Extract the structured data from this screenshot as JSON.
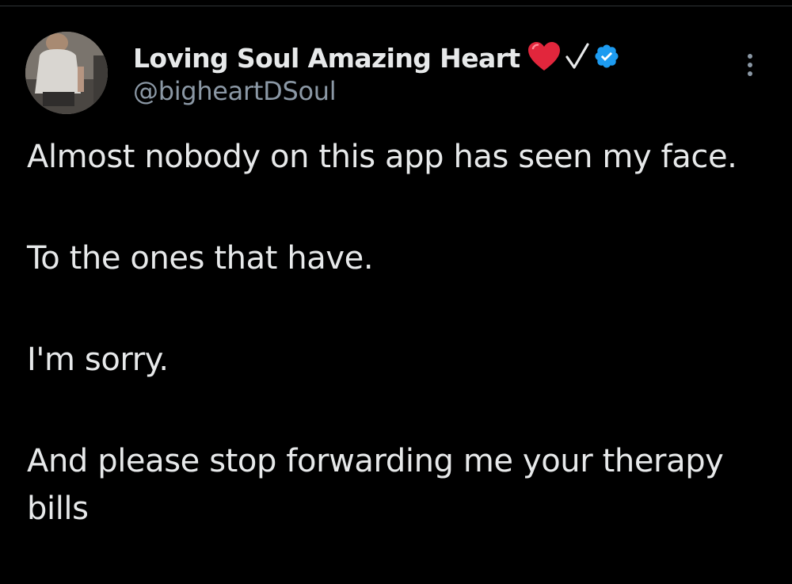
{
  "author": {
    "display_name": "Loving Soul Amazing Heart",
    "handle": "@bigheartDSoul",
    "name_emoji": "heart",
    "name_symbol": "√",
    "verified": true,
    "verified_color": "#1d9bf0",
    "heart_color": "#e2263c"
  },
  "menu": {
    "icon": "more-vertical-icon"
  },
  "tweet": {
    "paragraphs": [
      "Almost nobody on this app has seen my face.",
      "To the ones that have.",
      "I'm sorry.",
      "And please stop forwarding me your therapy bills"
    ]
  },
  "colors": {
    "background": "#000000",
    "primary_text": "#e7e9ea",
    "secondary_text": "#8b98a5"
  }
}
